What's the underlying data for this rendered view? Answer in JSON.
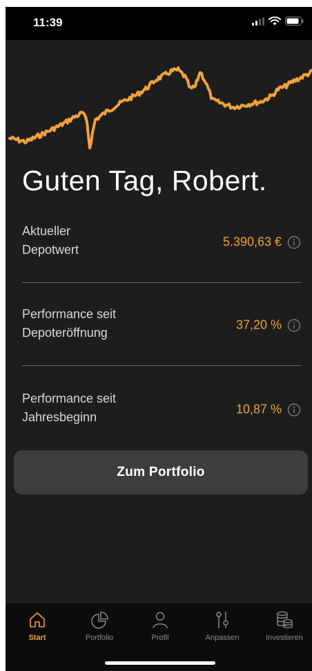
{
  "status_bar": {
    "time": "11:39",
    "icons": [
      "signal-icon",
      "wifi-icon",
      "battery-icon"
    ]
  },
  "chart": {
    "stroke_color": "#f0a23c",
    "description_only": false
  },
  "greeting": "Guten Tag, Robert.",
  "metrics": [
    {
      "label_line1": "Aktueller",
      "label_line2": "Depotwert",
      "value": "5.390,63 €"
    },
    {
      "label_line1": "Performance seit",
      "label_line2": "Depoteröffnung",
      "value": "37,20 %"
    },
    {
      "label_line1": "Performance seit",
      "label_line2": "Jahresbeginn",
      "value": "10,87 %"
    }
  ],
  "portfolio_button_label": "Zum Portfolio",
  "tabs": [
    {
      "label": "Start",
      "icon": "home-icon",
      "active": true
    },
    {
      "label": "Portfolio",
      "icon": "pie-chart-icon",
      "active": false
    },
    {
      "label": "Profil",
      "icon": "person-icon",
      "active": false
    },
    {
      "label": "Anpassen",
      "icon": "sliders-icon",
      "active": false
    },
    {
      "label": "Investieren",
      "icon": "coins-icon",
      "active": false
    }
  ],
  "colors": {
    "accent": "#f0a23c",
    "background": "#1d1d1d",
    "tab_bar": "#0c0c0c",
    "button": "#3d3d3d"
  }
}
